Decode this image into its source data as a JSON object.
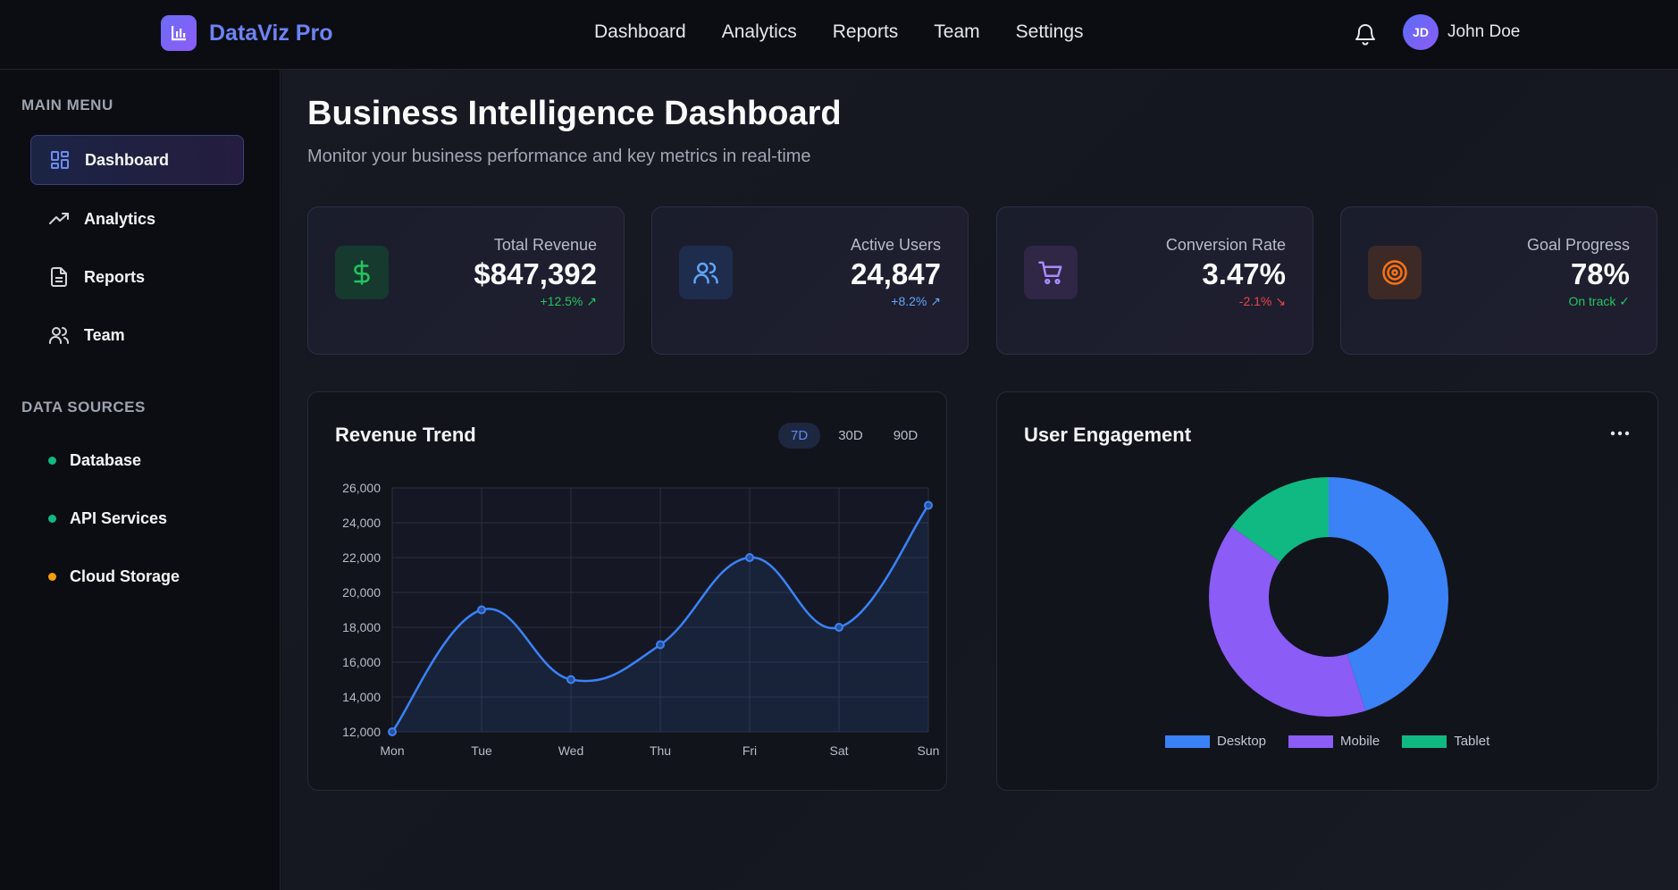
{
  "app": {
    "name": "DataViz Pro"
  },
  "topnav": [
    "Dashboard",
    "Analytics",
    "Reports",
    "Team",
    "Settings"
  ],
  "user": {
    "initials": "JD",
    "name": "John Doe"
  },
  "sidebar": {
    "main_heading": "MAIN MENU",
    "items": [
      "Dashboard",
      "Analytics",
      "Reports",
      "Team"
    ],
    "sources_heading": "DATA SOURCES",
    "sources": [
      {
        "label": "Database",
        "status_color": "#10b981"
      },
      {
        "label": "API Services",
        "status_color": "#10b981"
      },
      {
        "label": "Cloud Storage",
        "status_color": "#f59e0b"
      }
    ]
  },
  "page": {
    "title": "Business Intelligence Dashboard",
    "subtitle": "Monitor your business performance and key metrics in real-time"
  },
  "cards": [
    {
      "label": "Total Revenue",
      "value": "$847,392",
      "delta": "+12.5% ↗",
      "delta_color": "#22c55e",
      "icon": "dollar-icon",
      "icon_bg": "#163a2e",
      "icon_color": "#22c55e"
    },
    {
      "label": "Active Users",
      "value": "24,847",
      "delta": "+8.2% ↗",
      "delta_color": "#60a5fa",
      "icon": "users-icon",
      "icon_bg": "#1e2c4e",
      "icon_color": "#60a5fa"
    },
    {
      "label": "Conversion Rate",
      "value": "3.47%",
      "delta": "-2.1% ↘",
      "delta_color": "#ef4444",
      "icon": "cart-icon",
      "icon_bg": "#302645",
      "icon_color": "#a78bfa"
    },
    {
      "label": "Goal Progress",
      "value": "78%",
      "delta": "On track ✓",
      "delta_color": "#22c55e",
      "icon": "target-icon",
      "icon_bg": "#3d2a26",
      "icon_color": "#f97316"
    }
  ],
  "revenue_panel": {
    "title": "Revenue Trend",
    "ranges": [
      "7D",
      "30D",
      "90D"
    ],
    "active_range": "7D"
  },
  "engagement_panel": {
    "title": "User Engagement"
  },
  "chart_data": [
    {
      "type": "line",
      "title": "Revenue Trend",
      "categories": [
        "Mon",
        "Tue",
        "Wed",
        "Thu",
        "Fri",
        "Sat",
        "Sun"
      ],
      "values": [
        12000,
        19000,
        15000,
        17000,
        22000,
        18000,
        25000
      ],
      "ylim": [
        12000,
        26000
      ],
      "yticks": [
        "26,000",
        "24,000",
        "22,000",
        "20,000",
        "18,000",
        "16,000",
        "14,000",
        "12,000"
      ],
      "ytick_values": [
        26000,
        24000,
        22000,
        20000,
        18000,
        16000,
        14000,
        12000
      ],
      "color": "#3b82f6",
      "grid": true
    },
    {
      "type": "pie",
      "title": "User Engagement",
      "donut": true,
      "categories": [
        "Desktop",
        "Mobile",
        "Tablet"
      ],
      "values": [
        45,
        40,
        15
      ],
      "colors": [
        "#3b82f6",
        "#8b5cf6",
        "#10b981"
      ],
      "legend": "bottom"
    }
  ]
}
